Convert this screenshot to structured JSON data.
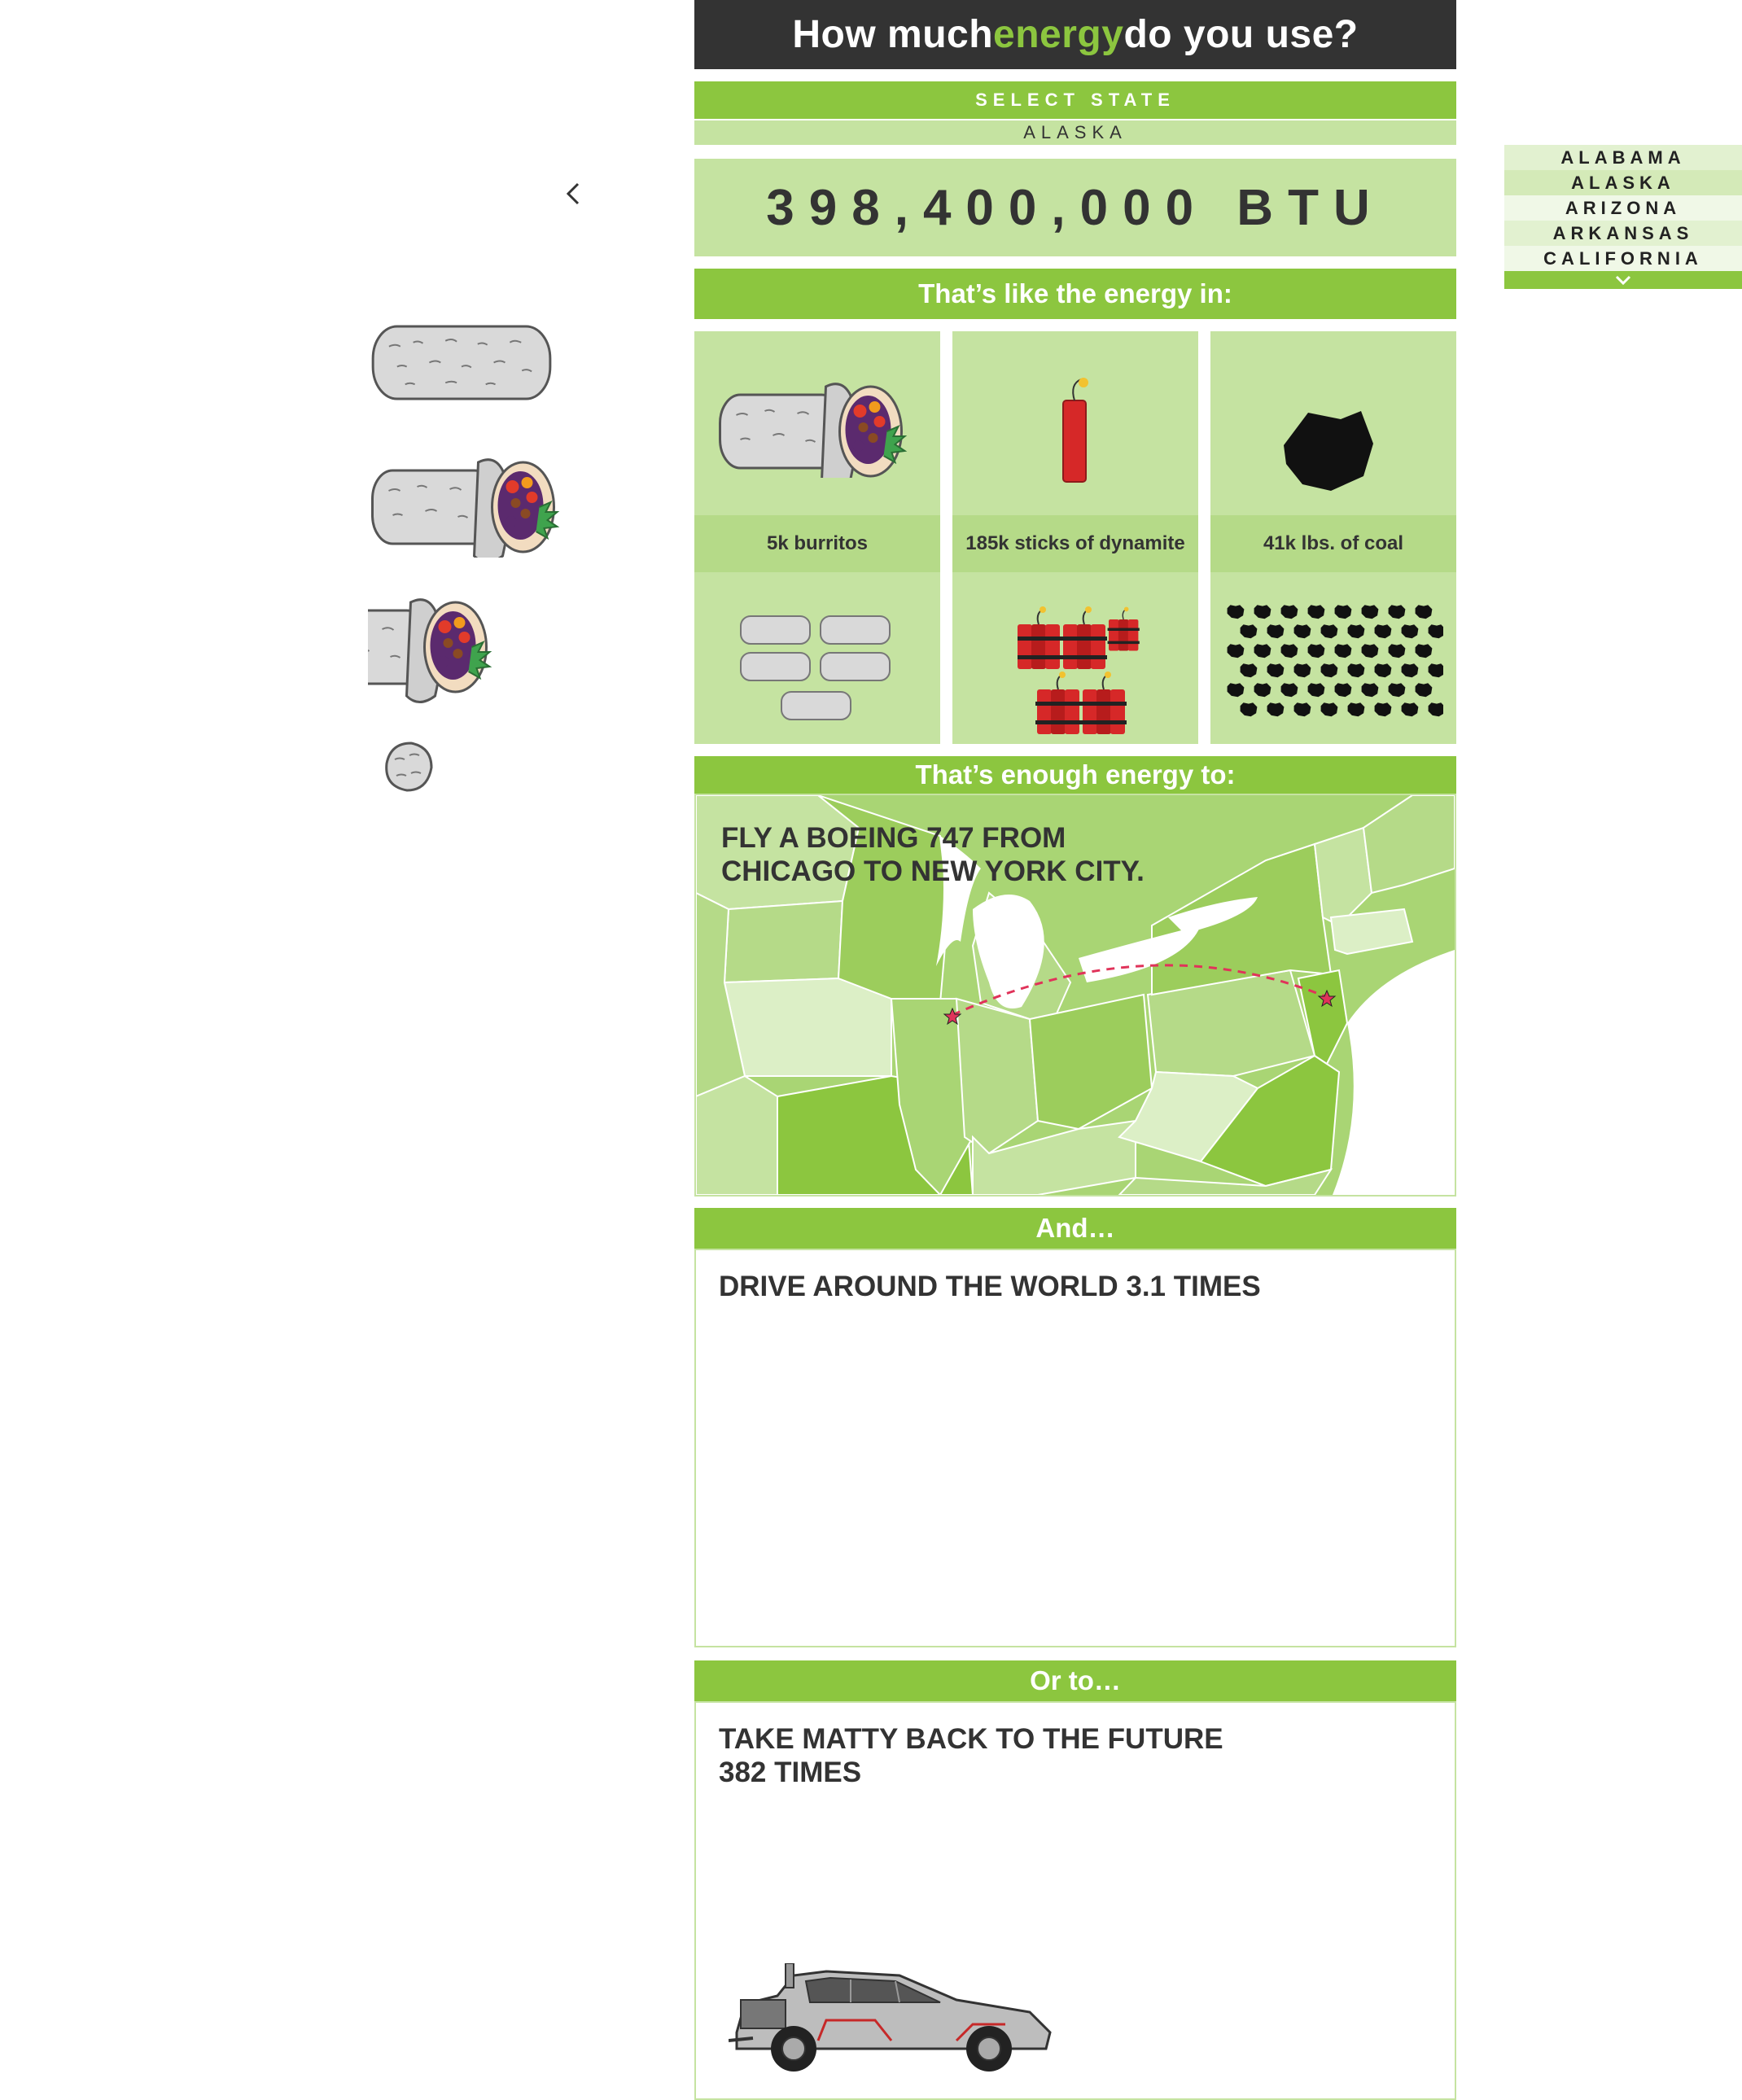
{
  "header": {
    "title_before": "How much ",
    "title_highlight": "energy",
    "title_after": " do you use?"
  },
  "state_selector": {
    "label": "SELECT STATE",
    "selected": "ALASKA"
  },
  "energy": {
    "value": "398,400,000 BTU"
  },
  "equivalents": {
    "heading": "That’s like the energy in:",
    "items": [
      {
        "label": "5k burritos",
        "icon": "burrito-icon"
      },
      {
        "label": "185k sticks of dynamite",
        "icon": "dynamite-icon"
      },
      {
        "label": "41k lbs. of coal",
        "icon": "coal-icon"
      }
    ]
  },
  "flight": {
    "heading": "That’s enough energy to:",
    "line1": "FLY A BOEING 747 FROM",
    "line2": "CHICAGO TO NEW YORK CITY."
  },
  "drive": {
    "heading": "And…",
    "text": "DRIVE AROUND THE WORLD 3.1 TIMES"
  },
  "future": {
    "heading": "Or to…",
    "line1": "TAKE MATTY BACK TO THE FUTURE",
    "line2": "382 TIMES"
  },
  "dropdown": {
    "options": [
      "ALABAMA",
      "ALASKA",
      "ARIZONA",
      "ARKANSAS",
      "CALIFORNIA"
    ],
    "selected_index": 1
  },
  "colors": {
    "accent": "#8cc63f",
    "accent_light": "#c5e3a1",
    "dark": "#333333"
  }
}
